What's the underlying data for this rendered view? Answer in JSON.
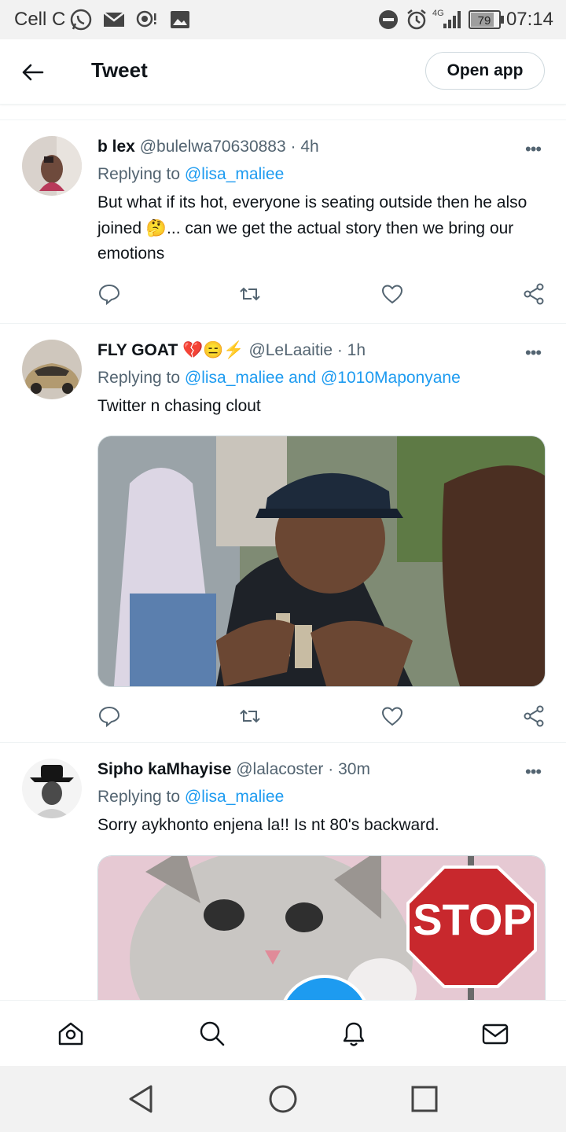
{
  "status_bar": {
    "carrier": "Cell C",
    "network": "4G",
    "battery": "79",
    "time": "07:14",
    "icons": [
      "whatsapp-icon",
      "mail-icon",
      "hotspot-icon",
      "image-icon",
      "dnd-icon",
      "alarm-icon",
      "signal-icon",
      "battery-icon"
    ]
  },
  "header": {
    "title": "Tweet",
    "open_app": "Open app"
  },
  "tweets": [
    {
      "name": "b lex",
      "handle": "@bulelwa70630883",
      "time": "· 4h",
      "replying_prefix": "Replying to ",
      "mentions": "@lisa_maliee",
      "text_1": "But what if its hot, everyone is seating outside then he also joined ",
      "emoji": "🤔",
      "text_2": "... can we get the actual story then we bring our emotions"
    },
    {
      "name": "FLY GOAT",
      "name_emojis": "💔😑⚡",
      "handle": "@LeLaaitie",
      "time": "· 1h",
      "replying_prefix": "Replying to ",
      "mentions": "@lisa_maliee and @1010Maponyane",
      "text": "Twitter n chasing clout"
    },
    {
      "name": "Sipho kaMhayise",
      "handle": "@lalacoster",
      "time": "· 30m",
      "replying_prefix": "Replying to ",
      "mentions": "@lisa_maliee",
      "text": "Sorry aykhonto enjena la!! Is nt 80's backward.",
      "sign_text": "STOP"
    }
  ],
  "more_label": "•••",
  "colors": {
    "accent": "#1d9bf0",
    "text": "#0f1419",
    "secondary": "#536471",
    "divider": "#eff3f4"
  }
}
